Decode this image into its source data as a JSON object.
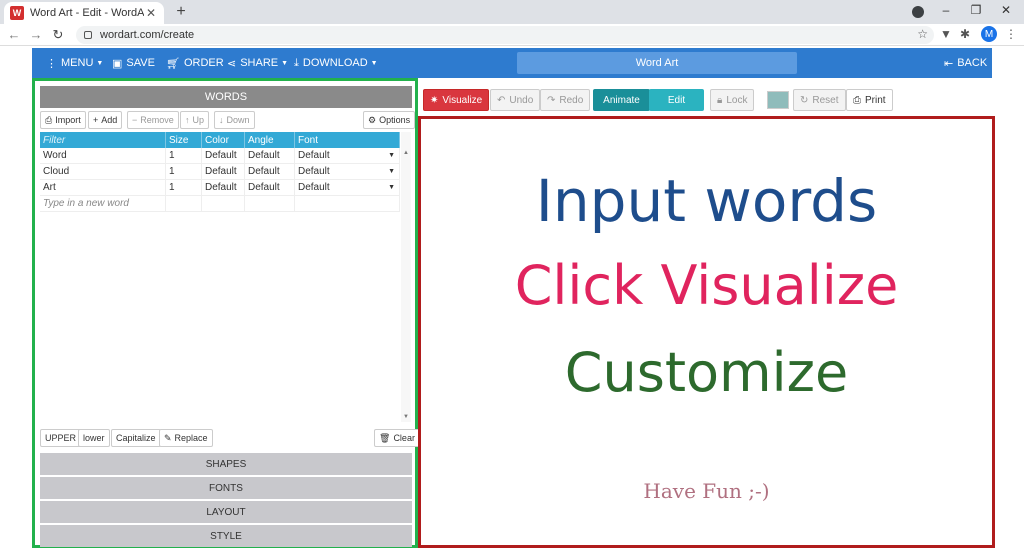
{
  "browser": {
    "tab_title": "Word Art - Edit - WordArt.com",
    "tab_close": "✕",
    "new_tab": "+",
    "url": "wordart.com/create",
    "favicon": "W",
    "profile_initial": "M",
    "icons": [
      "back-icon",
      "forward-icon",
      "reload-icon",
      "lock-icon",
      "star-icon",
      "extension-icon",
      "puzzle-icon",
      "kebab-icon"
    ]
  },
  "appnav": {
    "menu": "MENU",
    "save": "SAVE",
    "order": "ORDER",
    "share": "SHARE",
    "download": "DOWNLOAD",
    "title": "Word Art",
    "back": "BACK"
  },
  "words_panel": {
    "header": "WORDS",
    "import": "Import",
    "add": "Add",
    "remove": "Remove",
    "up": "Up",
    "down": "Down",
    "options": "Options",
    "columns": [
      "Filter",
      "Size",
      "Color",
      "Angle",
      "Font"
    ],
    "rows": [
      {
        "word": "Word",
        "size": "1",
        "color": "Default",
        "angle": "Default",
        "font": "Default"
      },
      {
        "word": "Cloud",
        "size": "1",
        "color": "Default",
        "angle": "Default",
        "font": "Default"
      },
      {
        "word": "Art",
        "size": "1",
        "color": "Default",
        "angle": "Default",
        "font": "Default"
      }
    ],
    "new_word_placeholder": "Type in a new word",
    "upper": "UPPER",
    "lower": "lower",
    "capitalize": "Capitalize",
    "replace": "Replace",
    "clear": "Clear"
  },
  "sections": {
    "shapes": "SHAPES",
    "fonts": "FONTS",
    "layout": "LAYOUT",
    "style": "STYLE"
  },
  "right_toolbar": {
    "visualize": "Visualize",
    "undo": "Undo",
    "redo": "Redo",
    "animate": "Animate",
    "edit": "Edit",
    "lock": "Lock",
    "reset": "Reset",
    "print": "Print",
    "swatch_color": "#8fbcbb"
  },
  "canvas": {
    "line1": "Input words",
    "line2": "Click Visualize",
    "line3": "Customize",
    "line4": "Have Fun ;-)",
    "colors": {
      "line1": "#1e4d8c",
      "line2": "#e0245e",
      "line3": "#2d6a2d",
      "line4": "#b07080"
    }
  }
}
